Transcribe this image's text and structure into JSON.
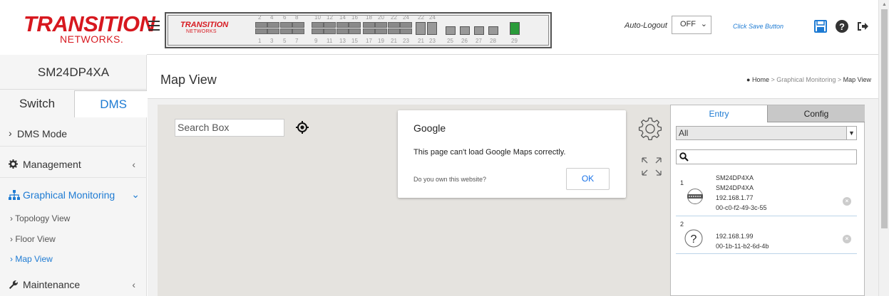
{
  "brand": {
    "logo_main": "TRANSITION",
    "logo_sub": "NETWORKS.",
    "panel_logo_main": "TRANSITION",
    "panel_logo_sub": "NETWORKS",
    "accent": "#1e7bd3",
    "logo_color": "#d7181f"
  },
  "port_panel": {
    "top_numbers": [
      "2",
      "4",
      "6",
      "8",
      "10",
      "12",
      "14",
      "16",
      "18",
      "20",
      "22",
      "24",
      "22",
      "24"
    ],
    "bottom_numbers": [
      "1",
      "3",
      "5",
      "7",
      "9",
      "11",
      "13",
      "15",
      "17",
      "19",
      "21",
      "23",
      "21",
      "23",
      "25",
      "26",
      "27",
      "28",
      "29"
    ]
  },
  "topbar": {
    "autologout_label": "Auto-Logout",
    "autologout_value": "OFF",
    "save_hint": "Click Save Button"
  },
  "sidebar": {
    "device_name": "SM24DP4XA",
    "tabs": [
      {
        "label": "Switch"
      },
      {
        "label": "DMS"
      }
    ],
    "items": [
      {
        "label": "DMS Mode",
        "icon": "chevron-right-icon"
      },
      {
        "label": "Management",
        "icon": "gear-icon"
      },
      {
        "label": "Graphical Monitoring",
        "icon": "sitemap-icon"
      },
      {
        "label": "Maintenance",
        "icon": "wrench-icon"
      }
    ],
    "subitems": [
      {
        "label": "Topology View"
      },
      {
        "label": "Floor View"
      },
      {
        "label": "Map View"
      }
    ]
  },
  "header": {
    "title": "Map View",
    "breadcrumb": {
      "home": "Home",
      "sep": ">",
      "parent": "Graphical Monitoring",
      "current": "Map View"
    }
  },
  "map": {
    "search_value": "Search Box",
    "dialog": {
      "title": "Google",
      "message": "This page can't load Google Maps correctly.",
      "owner_link": "Do you own this website?",
      "ok": "OK"
    }
  },
  "right_panel": {
    "tabs": [
      {
        "label": "Entry"
      },
      {
        "label": "Config"
      }
    ],
    "filter_value": "All",
    "entries": [
      {
        "index": "1",
        "lines": [
          "SM24DP4XA",
          "SM24DP4XA",
          "192.168.1.77",
          "00-c0-f2-49-3c-55"
        ],
        "icon": "switch-device-icon"
      },
      {
        "index": "2",
        "lines": [
          "192.168.1.99",
          "00-1b-11-b2-6d-4b"
        ],
        "icon": "unknown-device-icon"
      }
    ]
  }
}
